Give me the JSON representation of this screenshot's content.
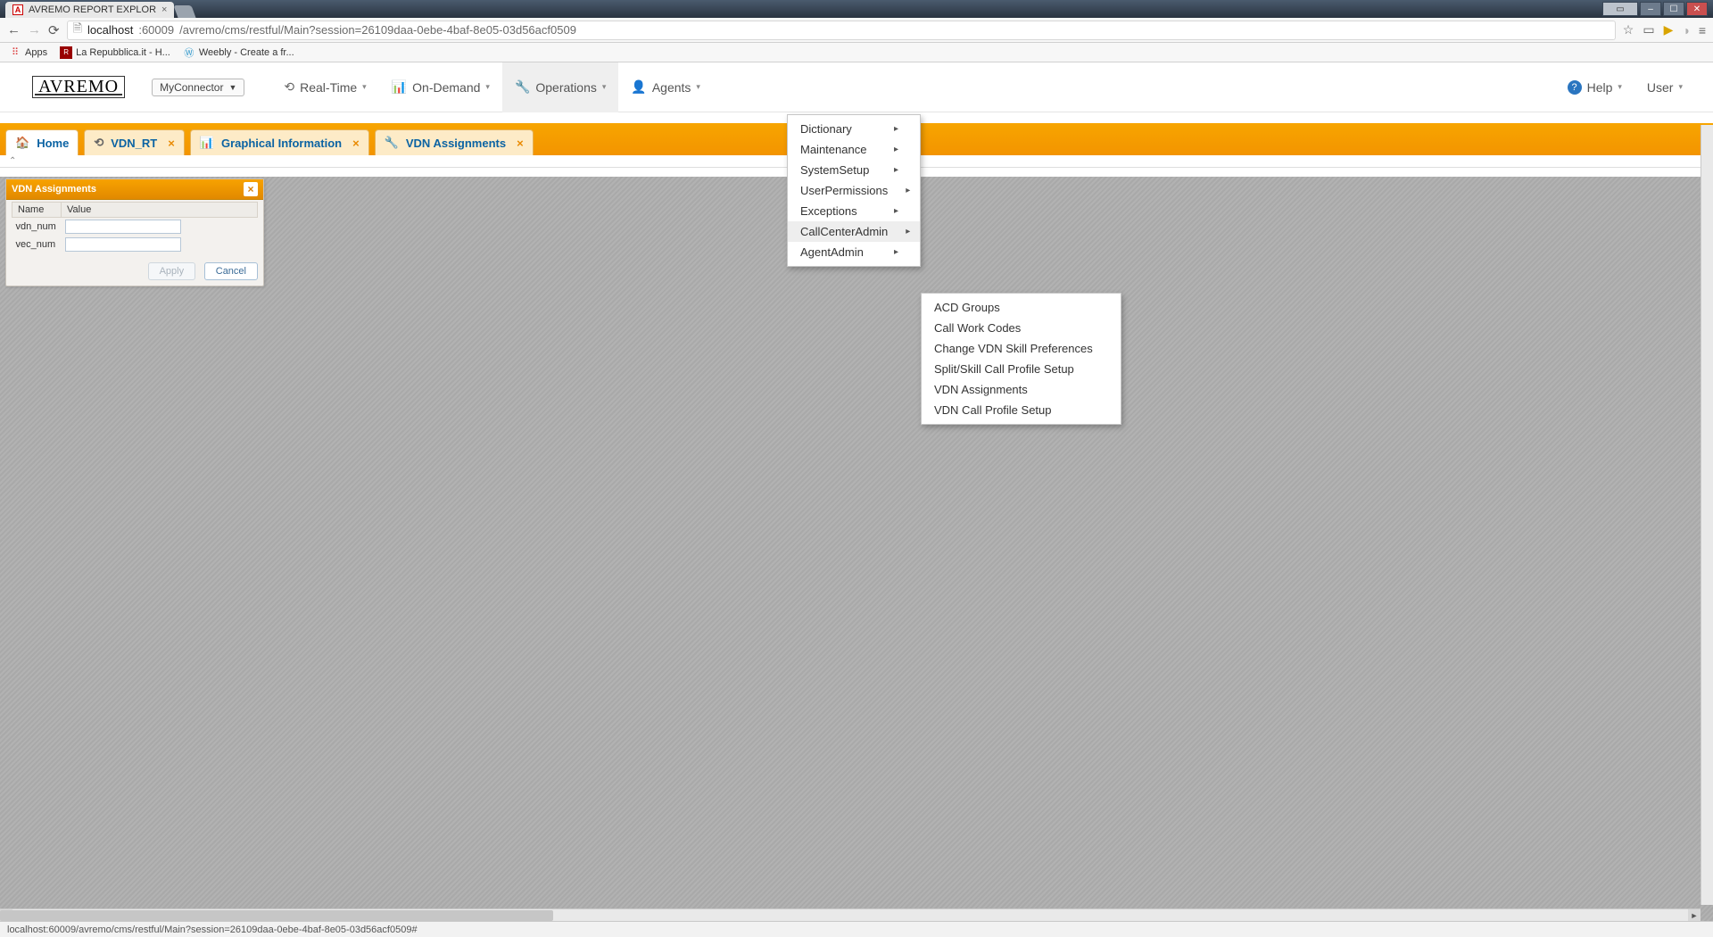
{
  "browser": {
    "tab_title": "AVREMO REPORT EXPLOR",
    "url_host": "localhost",
    "url_port": ":60009",
    "url_path": "/avremo/cms/restful/Main?session=26109daa-0ebe-4baf-8e05-03d56acf0509",
    "bookmarks_label": "Apps",
    "bookmark1": "La Repubblica.it - H...",
    "bookmark2": "Weebly - Create a fr...",
    "status_text": "localhost:60009/avremo/cms/restful/Main?session=26109daa-0ebe-4baf-8e05-03d56acf0509#"
  },
  "app": {
    "brand": "AVREMO",
    "connector_label": "MyConnector",
    "menu": {
      "realtime": "Real-Time",
      "ondemand": "On-Demand",
      "operations": "Operations",
      "agents": "Agents",
      "help": "Help",
      "user": "User"
    }
  },
  "tabs": {
    "home": "Home",
    "vdn_rt": "VDN_RT",
    "graphical": "Graphical Information",
    "vdn_assign": "VDN Assignments"
  },
  "panel": {
    "title": "VDN Assignments",
    "col_name": "Name",
    "col_value": "Value",
    "row1_name": "vdn_num",
    "row2_name": "vec_num",
    "apply": "Apply",
    "cancel": "Cancel"
  },
  "ops_menu": {
    "dictionary": "Dictionary",
    "maintenance": "Maintenance",
    "systemsetup": "SystemSetup",
    "userperm": "UserPermissions",
    "exceptions": "Exceptions",
    "callcenter": "CallCenterAdmin",
    "agentadmin": "AgentAdmin"
  },
  "sub_menu": {
    "acd": "ACD Groups",
    "cwc": "Call Work Codes",
    "cvsp": "Change VDN Skill Preferences",
    "sscp": "Split/Skill Call Profile Setup",
    "vdna": "VDN Assignments",
    "vdncp": "VDN Call Profile Setup"
  }
}
